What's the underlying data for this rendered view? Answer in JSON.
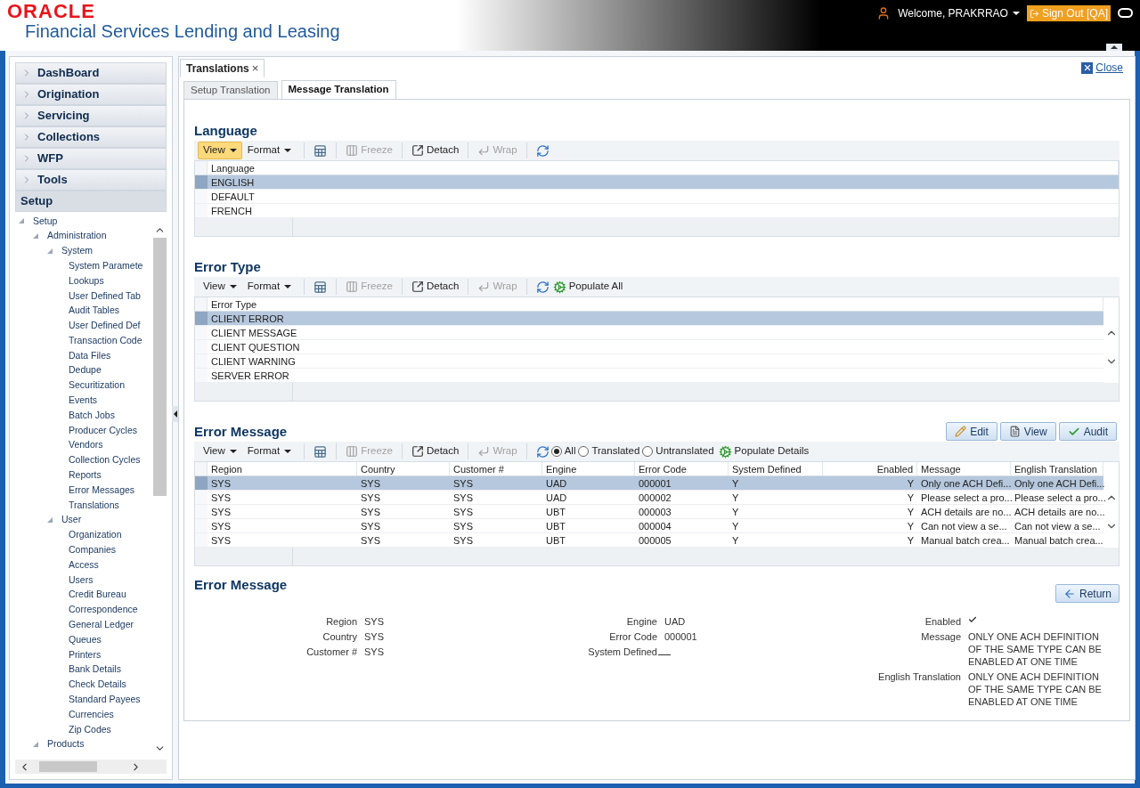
{
  "header": {
    "logo": "ORACLE",
    "product": "Financial Services Lending and Leasing",
    "welcome": "Welcome, PRAKRRAO",
    "sign_out": "Sign Out [QA]"
  },
  "sidebar": {
    "sections": [
      {
        "label": "DashBoard",
        "expanded": false
      },
      {
        "label": "Origination",
        "expanded": false
      },
      {
        "label": "Servicing",
        "expanded": false
      },
      {
        "label": "Collections",
        "expanded": false
      },
      {
        "label": "WFP",
        "expanded": false
      },
      {
        "label": "Tools",
        "expanded": false
      },
      {
        "label": "Setup",
        "expanded": true
      }
    ],
    "tree": [
      {
        "label": "Setup",
        "expanded": true,
        "children": [
          {
            "label": "Administration",
            "expanded": true,
            "children": [
              {
                "label": "System",
                "expanded": true,
                "children": [
                  {
                    "label": "System Paramete"
                  },
                  {
                    "label": "Lookups"
                  },
                  {
                    "label": "User Defined Tab"
                  },
                  {
                    "label": "Audit Tables"
                  },
                  {
                    "label": "User Defined Def"
                  },
                  {
                    "label": "Transaction Code"
                  },
                  {
                    "label": "Data Files"
                  },
                  {
                    "label": "Dedupe"
                  },
                  {
                    "label": "Securitization"
                  },
                  {
                    "label": "Events"
                  },
                  {
                    "label": "Batch Jobs"
                  },
                  {
                    "label": "Producer Cycles"
                  },
                  {
                    "label": "Vendors"
                  },
                  {
                    "label": "Collection Cycles"
                  },
                  {
                    "label": "Reports"
                  },
                  {
                    "label": "Error Messages"
                  },
                  {
                    "label": "Translations"
                  }
                ]
              },
              {
                "label": "User",
                "expanded": true,
                "children": [
                  {
                    "label": "Organization"
                  },
                  {
                    "label": "Companies"
                  },
                  {
                    "label": "Access"
                  },
                  {
                    "label": "Users"
                  },
                  {
                    "label": "Credit Bureau"
                  },
                  {
                    "label": "Correspondence"
                  },
                  {
                    "label": "General Ledger"
                  },
                  {
                    "label": "Queues"
                  },
                  {
                    "label": "Printers"
                  },
                  {
                    "label": "Bank Details"
                  },
                  {
                    "label": "Check Details"
                  },
                  {
                    "label": "Standard Payees"
                  },
                  {
                    "label": "Currencies"
                  },
                  {
                    "label": "Zip Codes"
                  }
                ]
              }
            ]
          },
          {
            "label": "Products",
            "expanded": true
          }
        ]
      }
    ]
  },
  "main": {
    "tab": {
      "label": "Translations",
      "close": "×"
    },
    "close_link": "Close",
    "subtabs": [
      {
        "label": "Setup Translation",
        "selected": false
      },
      {
        "label": "Message Translation",
        "selected": true
      }
    ],
    "sections": [
      {
        "title": "Language",
        "toolbar": [
          {
            "kind": "menu",
            "label": "View",
            "active": true
          },
          {
            "kind": "menu",
            "label": "Format",
            "active": false
          },
          {
            "kind": "export"
          },
          {
            "kind": "freeze",
            "label": "Freeze",
            "disabled": true
          },
          {
            "kind": "detach",
            "label": "Detach",
            "disabled": false
          },
          {
            "kind": "wrap",
            "label": "Wrap",
            "disabled": true
          },
          {
            "kind": "refresh"
          }
        ],
        "grid": {
          "columns": [
            "Language"
          ],
          "rows": [
            {
              "cells": [
                "ENGLISH"
              ],
              "selected": true
            },
            {
              "cells": [
                "DEFAULT"
              ],
              "selected": false
            },
            {
              "cells": [
                "FRENCH"
              ],
              "selected": false
            }
          ]
        }
      },
      {
        "title": "Error Type",
        "toolbar": [
          {
            "kind": "menu",
            "label": "View",
            "active": false
          },
          {
            "kind": "menu",
            "label": "Format",
            "active": false
          },
          {
            "kind": "export"
          },
          {
            "kind": "freeze",
            "label": "Freeze",
            "disabled": true
          },
          {
            "kind": "detach",
            "label": "Detach",
            "disabled": false
          },
          {
            "kind": "wrap",
            "label": "Wrap",
            "disabled": true
          },
          {
            "kind": "refresh"
          },
          {
            "kind": "populate",
            "label": "Populate All"
          }
        ],
        "grid": {
          "columns": [
            "Error Type"
          ],
          "rows": [
            {
              "cells": [
                "CLIENT ERROR"
              ],
              "selected": true
            },
            {
              "cells": [
                "CLIENT MESSAGE"
              ],
              "selected": false
            },
            {
              "cells": [
                "CLIENT QUESTION"
              ],
              "selected": false
            },
            {
              "cells": [
                "CLIENT WARNING"
              ],
              "selected": false
            },
            {
              "cells": [
                "SERVER ERROR"
              ],
              "selected": false
            }
          ]
        }
      },
      {
        "title": "Error Message",
        "actions": [
          {
            "kind": "edit",
            "label": "Edit"
          },
          {
            "kind": "view",
            "label": "View"
          },
          {
            "kind": "audit",
            "label": "Audit"
          }
        ],
        "toolbar": [
          {
            "kind": "menu",
            "label": "View",
            "active": false
          },
          {
            "kind": "menu",
            "label": "Format",
            "active": false
          },
          {
            "kind": "export"
          },
          {
            "kind": "freeze",
            "label": "Freeze",
            "disabled": true
          },
          {
            "kind": "detach",
            "label": "Detach",
            "disabled": false
          },
          {
            "kind": "wrap",
            "label": "Wrap",
            "disabled": true
          },
          {
            "kind": "refresh"
          },
          {
            "kind": "radio",
            "label": "All",
            "selected": true
          },
          {
            "kind": "radio",
            "label": "Translated",
            "selected": false
          },
          {
            "kind": "radio",
            "label": "Untranslated",
            "selected": false
          },
          {
            "kind": "populate",
            "label": "Populate Details"
          }
        ],
        "grid": {
          "columns": [
            "Region",
            "Country",
            "Customer #",
            "Engine",
            "Error Code",
            "System Defined",
            "Enabled",
            "Message",
            "English Translation"
          ],
          "rows": [
            {
              "cells": [
                "SYS",
                "SYS",
                "SYS",
                "UAD",
                "000001",
                "Y",
                "Y",
                "Only one ACH Defi...",
                "Only one ACH Defi..."
              ],
              "selected": true
            },
            {
              "cells": [
                "SYS",
                "SYS",
                "SYS",
                "UAD",
                "000002",
                "Y",
                "Y",
                "Please select a pro...",
                "Please select a pro..."
              ],
              "selected": false
            },
            {
              "cells": [
                "SYS",
                "SYS",
                "SYS",
                "UBT",
                "000003",
                "Y",
                "Y",
                "ACH details are no...",
                "ACH details are no..."
              ],
              "selected": false
            },
            {
              "cells": [
                "SYS",
                "SYS",
                "SYS",
                "UBT",
                "000004",
                "Y",
                "Y",
                "Can not view a se...",
                "Can not view a se..."
              ],
              "selected": false
            },
            {
              "cells": [
                "SYS",
                "SYS",
                "SYS",
                "UBT",
                "000005",
                "Y",
                "Y",
                "Manual batch crea...",
                "Manual batch crea..."
              ],
              "selected": false
            }
          ]
        }
      }
    ],
    "detail": {
      "title": "Error Message",
      "return": "Return",
      "columns": [
        [
          {
            "label": "Region",
            "value": "SYS"
          },
          {
            "label": "Country",
            "value": "SYS"
          },
          {
            "label": "Customer #",
            "value": "SYS"
          }
        ],
        [
          {
            "label": "Engine",
            "value": "UAD"
          },
          {
            "label": "Error Code",
            "value": "000001"
          },
          {
            "label": "System Defined",
            "kind": "blank"
          }
        ],
        [
          {
            "label": "Enabled",
            "kind": "check",
            "checked": true
          },
          {
            "label": "Message",
            "value": "ONLY ONE ACH DEFINITION OF THE SAME TYPE CAN BE ENABLED AT ONE TIME"
          },
          {
            "label": "English Translation",
            "value": "ONLY ONE ACH DEFINITION OF THE SAME TYPE CAN BE ENABLED AT ONE TIME"
          }
        ]
      ]
    }
  }
}
